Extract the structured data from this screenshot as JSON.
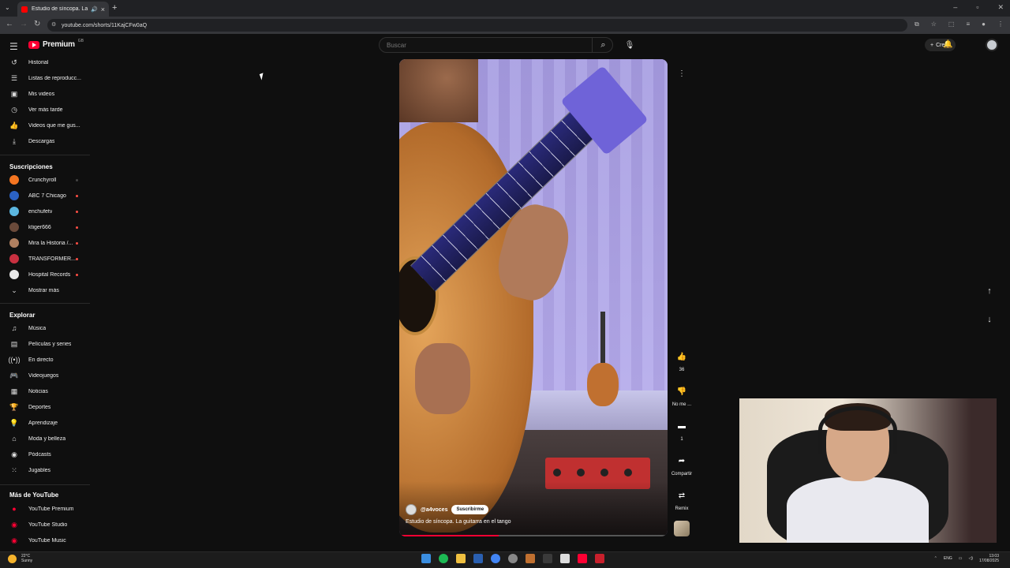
{
  "browser": {
    "tab_title": "Estudio de síncopa. La guita...",
    "url": "youtube.com/shorts/11KajCFw0aQ"
  },
  "header": {
    "logo_text": "Premium",
    "logo_region": "GB",
    "search_placeholder": "Buscar",
    "create_label": "Crear"
  },
  "sidebar": {
    "you_items": [
      {
        "label": "Historial",
        "icon": "history-icon"
      },
      {
        "label": "Listas de reproducc...",
        "icon": "playlist-icon"
      },
      {
        "label": "Mis videos",
        "icon": "video-icon"
      },
      {
        "label": "Ver más tarde",
        "icon": "clock-icon"
      },
      {
        "label": "Videos que me gus...",
        "icon": "thumbs-up-icon"
      },
      {
        "label": "Descargas",
        "icon": "download-icon"
      }
    ],
    "subscriptions_heading": "Suscripciones",
    "subscriptions": [
      {
        "label": "Crunchyroll",
        "color": "#f47521"
      },
      {
        "label": "ABC 7 Chicago",
        "color": "#2b62c4"
      },
      {
        "label": "enchufetv",
        "color": "#5bb6e0"
      },
      {
        "label": "ktiger666",
        "color": "#6a4a3a"
      },
      {
        "label": "Mira la Historia /...",
        "color": "#b08060"
      },
      {
        "label": "TRANSFORMER...",
        "color": "#c83040"
      },
      {
        "label": "Hospital Records",
        "color": "#e8e8e8"
      }
    ],
    "show_more": "Mostrar más",
    "explore_heading": "Explorar",
    "explore_items": [
      {
        "label": "Música",
        "icon": "music-icon"
      },
      {
        "label": "Películas y series",
        "icon": "film-icon"
      },
      {
        "label": "En directo",
        "icon": "live-icon"
      },
      {
        "label": "Videojuegos",
        "icon": "gamepad-icon"
      },
      {
        "label": "Noticias",
        "icon": "news-icon"
      },
      {
        "label": "Deportes",
        "icon": "trophy-icon"
      },
      {
        "label": "Aprendizaje",
        "icon": "lightbulb-icon"
      },
      {
        "label": "Moda y belleza",
        "icon": "hanger-icon"
      },
      {
        "label": "Pódcasts",
        "icon": "podcast-icon"
      },
      {
        "label": "Jugables",
        "icon": "grid-icon"
      }
    ],
    "more_heading": "Más de YouTube",
    "more_items": [
      {
        "label": "YouTube Premium"
      },
      {
        "label": "YouTube Studio"
      },
      {
        "label": "YouTube Music"
      }
    ]
  },
  "short": {
    "channel": "@a4voces",
    "subscribe_label": "Suscribirme",
    "title": "Estudio de síncopa. La guitarra en el tango",
    "progress": 0.37,
    "likes": "36",
    "dislike_label": "No me ...",
    "comments": "1",
    "share_label": "Compartir",
    "remix_label": "Remix"
  },
  "taskbar": {
    "temperature": "22°C",
    "weather": "Sunny",
    "lang": "ENG",
    "time": "13:03",
    "date": "17/08/2025"
  }
}
